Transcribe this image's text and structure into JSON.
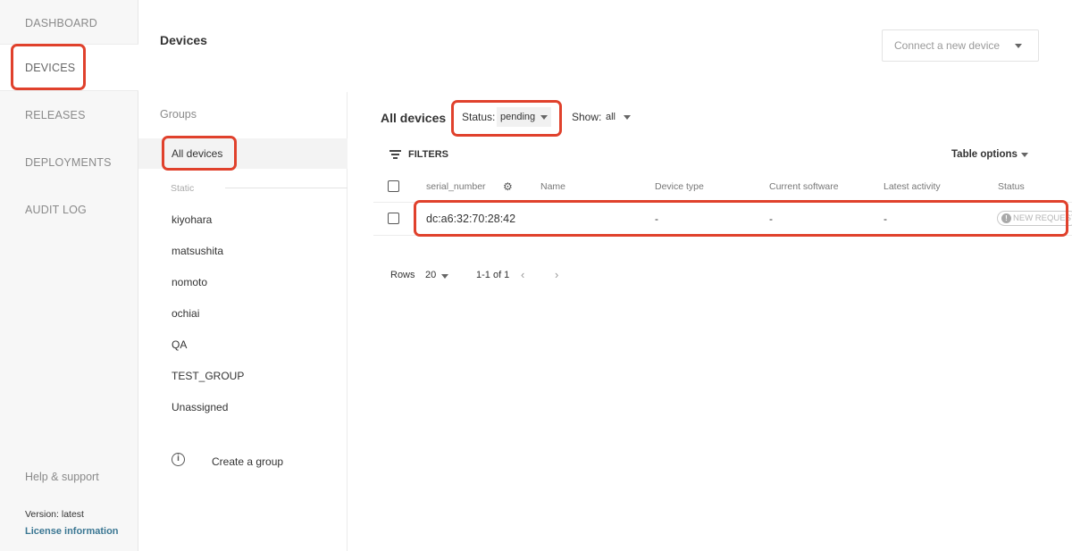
{
  "nav": {
    "items": [
      {
        "label": "DASHBOARD"
      },
      {
        "label": "DEVICES"
      },
      {
        "label": "RELEASES"
      },
      {
        "label": "DEPLOYMENTS"
      },
      {
        "label": "AUDIT LOG"
      }
    ],
    "help": "Help & support",
    "version": "Version: latest",
    "license": "License information"
  },
  "header": {
    "title": "Devices",
    "connect": "Connect a new device"
  },
  "groups": {
    "title": "Groups",
    "all": "All devices",
    "static": "Static",
    "items": [
      "kiyohara",
      "matsushita",
      "nomoto",
      "ochiai",
      "QA",
      "TEST_GROUP",
      "Unassigned"
    ],
    "create": "Create a group"
  },
  "main": {
    "title": "All devices",
    "status_label": "Status:",
    "status_value": "pending",
    "show_label": "Show:",
    "show_value": "all",
    "filters": "FILTERS",
    "table_options": "Table options"
  },
  "table": {
    "columns": [
      "serial_number",
      "Name",
      "Device type",
      "Current software",
      "Latest activity",
      "Status"
    ],
    "rows": [
      {
        "serial": "dc:a6:32:70:28:42",
        "name": "",
        "device_type": "-",
        "software": "-",
        "activity": "-",
        "status": "NEW REQUEST"
      }
    ]
  },
  "pager": {
    "rows_label": "Rows",
    "rows_value": "20",
    "range": "1-1 of 1"
  },
  "colors": {
    "accent_link": "#3b7793",
    "highlight": "#e0412c"
  }
}
